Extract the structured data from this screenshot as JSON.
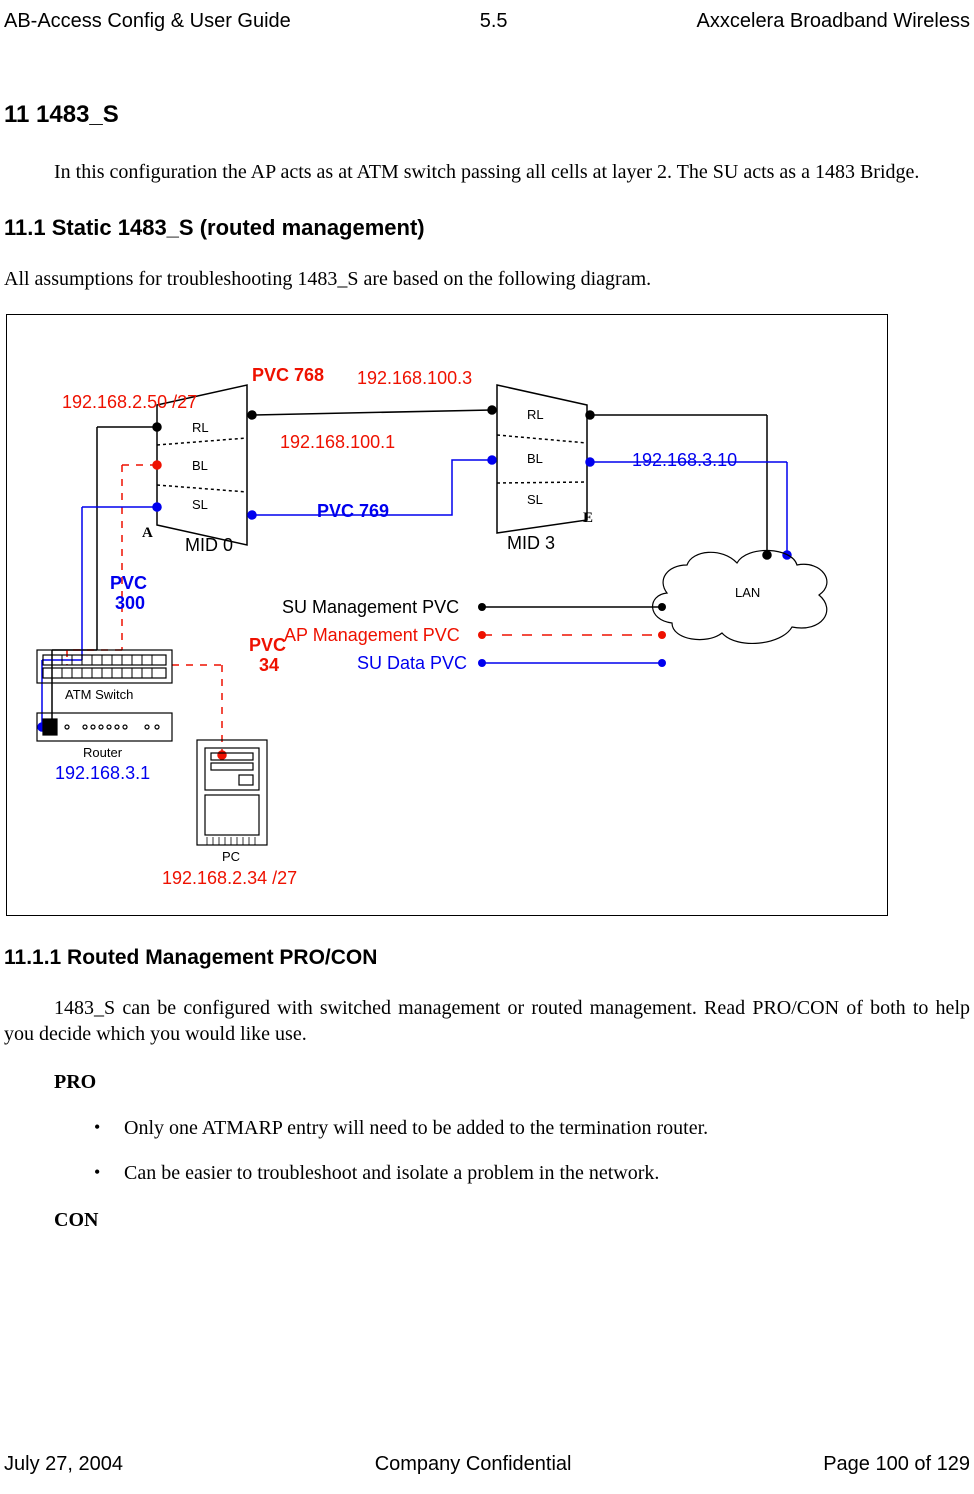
{
  "header": {
    "left": "AB-Access Config & User Guide",
    "center": "5.5",
    "right": "Axxcelera Broadband Wireless"
  },
  "section11": {
    "number_title": "11  1483_S",
    "intro": "In this configuration the AP acts as at ATM switch passing all cells at layer 2. The SU acts as a 1483 Bridge."
  },
  "section11_1": {
    "number_title": "11.1 Static 1483_S (routed management)",
    "intro": "All assumptions for troubleshooting 1483_S are based on the following diagram."
  },
  "diagram": {
    "pvc768": "PVC 768",
    "pvc769": "PVC 769",
    "pvc300_line1": "PVC",
    "pvc300_line2": "300",
    "pvc34_line1": "PVC",
    "pvc34_line2": "34",
    "ip_2_50": "192.168.2.50 /27",
    "ip_100_1": "192.168.100.1",
    "ip_100_3": "192.168.100.3",
    "ip_3_10": "192.168.3.10",
    "ip_3_1": "192.168.3.1",
    "ip_2_34": "192.168.2.34 /27",
    "mid0": "MID 0",
    "mid3": "MID 3",
    "lan": "LAN",
    "atm_switch": "ATM Switch",
    "router": "Router",
    "pc": "PC",
    "legend_su_mgmt": "SU Management PVC",
    "legend_ap_mgmt": "AP Management PVC",
    "legend_su_data": "SU Data PVC",
    "layer_rl": "RL",
    "layer_bl": "BL",
    "layer_sl": "SL",
    "label_a": "A",
    "label_e": "E"
  },
  "section11_1_1": {
    "number_title": "11.1.1      Routed Management PRO/CON",
    "intro": "1483_S can be configured with switched management or routed management. Read PRO/CON of both to help you decide which you would like use.",
    "pro_heading": "PRO",
    "pro_items": [
      "Only one ATMARP entry will need to be added to the termination router.",
      "Can be easier to troubleshoot and isolate a problem in the network."
    ],
    "con_heading": "CON"
  },
  "footer": {
    "left": "July 27, 2004",
    "center": "Company Confidential",
    "right": "Page 100 of 129"
  }
}
